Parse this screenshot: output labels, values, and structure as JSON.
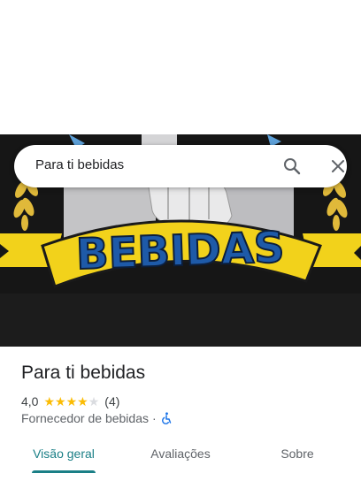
{
  "search": {
    "query": "Para ti bebidas"
  },
  "hero": {
    "sign_text": "BEBIDAS"
  },
  "place": {
    "name": "Para ti bebidas",
    "rating": "4,0",
    "stars_filled": 4,
    "stars_total": 5,
    "review_count": "(4)",
    "category": "Fornecedor de bebidas",
    "separator": "·"
  },
  "tabs": [
    {
      "label": "Visão geral",
      "active": true
    },
    {
      "label": "Avaliações",
      "active": false
    },
    {
      "label": "Sobre",
      "active": false
    }
  ],
  "colors": {
    "accent": "#1a7f86",
    "star": "#fbbc04",
    "sign_yellow": "#f2d21b",
    "sign_blue": "#1e5aa8",
    "wheelchair": "#1a73e8"
  },
  "icons": [
    "search-icon",
    "close-icon",
    "wheelchair-accessible-icon",
    "star-icon"
  ]
}
